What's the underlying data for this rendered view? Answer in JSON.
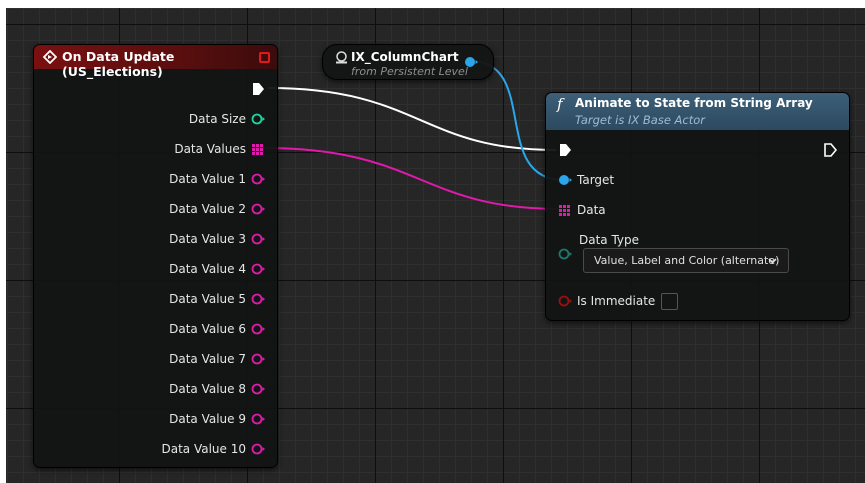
{
  "colors": {
    "exec": "#ffffff",
    "object": "#2aa6ea",
    "array_string": "#e01aaa",
    "integer": "#1ed6a0",
    "byte_enum": "#1b7a6a",
    "boolean": "#9a1010",
    "event_header": "#7a1010",
    "function_header": "#3d5f78"
  },
  "event_node": {
    "title": "On Data Update (US_Elections)",
    "icon": "event-diamond-icon",
    "outputs": [
      {
        "label": "Data Size",
        "type": "integer"
      },
      {
        "label": "Data Values",
        "type": "array_string"
      },
      {
        "label": "Data Value 1",
        "type": "string"
      },
      {
        "label": "Data Value 2",
        "type": "string"
      },
      {
        "label": "Data Value 3",
        "type": "string"
      },
      {
        "label": "Data Value 4",
        "type": "string"
      },
      {
        "label": "Data Value 5",
        "type": "string"
      },
      {
        "label": "Data Value 6",
        "type": "string"
      },
      {
        "label": "Data Value 7",
        "type": "string"
      },
      {
        "label": "Data Value 8",
        "type": "string"
      },
      {
        "label": "Data Value 9",
        "type": "string"
      },
      {
        "label": "Data Value 10",
        "type": "string"
      }
    ]
  },
  "variable_node": {
    "title": "IX_ColumnChart",
    "subtitle": "from Persistent Level",
    "icon": "world-actor-icon"
  },
  "function_node": {
    "glyph": "f",
    "title": "Animate to State from String Array",
    "subtitle": "Target is IX Base Actor",
    "inputs": {
      "target": "Target",
      "data": "Data",
      "data_type_label": "Data Type",
      "data_type_value": "Value, Label and Color (alternate)",
      "is_immediate": "Is Immediate"
    }
  }
}
